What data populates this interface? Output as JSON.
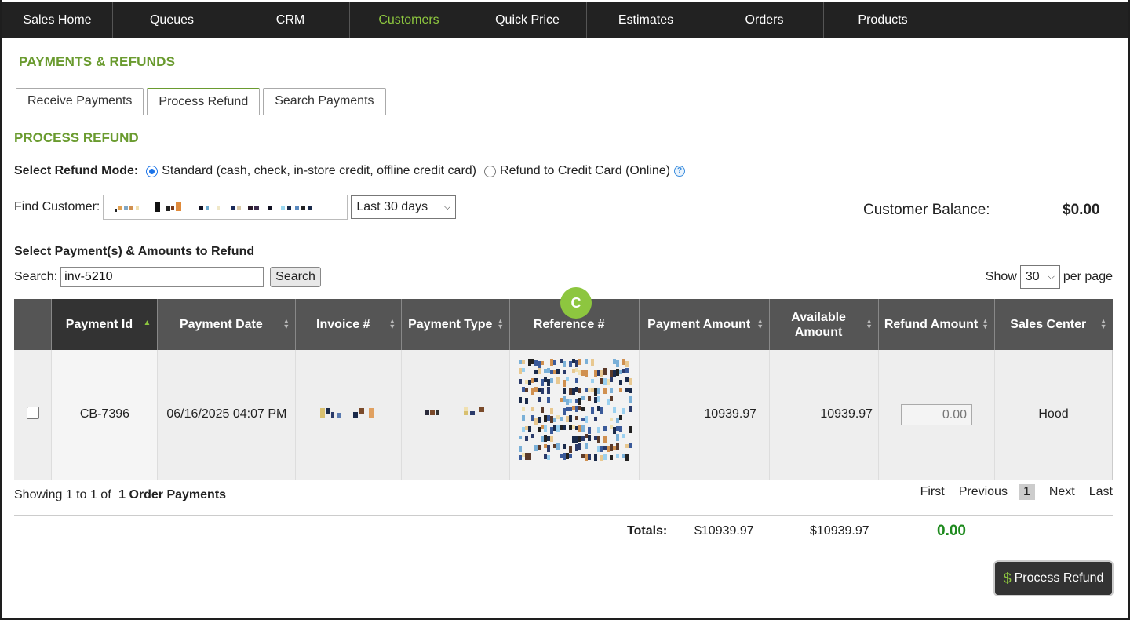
{
  "nav": {
    "items": [
      "Sales Home",
      "Queues",
      "CRM",
      "Customers",
      "Quick Price",
      "Estimates",
      "Orders",
      "Products"
    ],
    "active": "Customers",
    "active_color": "#8dc63f"
  },
  "page_title": "PAYMENTS & REFUNDS",
  "tabs": [
    "Receive Payments",
    "Process Refund",
    "Search Payments"
  ],
  "section_title": "PROCESS REFUND",
  "refund_mode": {
    "label": "Select Refund Mode:",
    "options": [
      "Standard (cash, check, in-store credit, offline credit card)",
      "Refund to Credit Card (Online)"
    ],
    "selected": 0,
    "help_icon": "help-icon"
  },
  "find_customer": {
    "label": "Find Customer:",
    "range": "Last 30 days"
  },
  "customer_balance": {
    "label": "Customer Balance:",
    "value": "$0.00"
  },
  "select_title": "Select Payment(s) & Amounts to Refund",
  "search": {
    "label": "Search:",
    "value": "inv-5210",
    "button": "Search"
  },
  "show": {
    "label": "Show",
    "value": "30",
    "suffix": "per page"
  },
  "table": {
    "headers": [
      "Payment Id",
      "Payment Date",
      "Invoice #",
      "Payment Type",
      "Reference #",
      "Payment Amount",
      "Available Amount",
      "Refund Amount",
      "Sales Center"
    ],
    "row": {
      "payment_id": "CB-7396",
      "payment_date": "06/16/2025 04:07 PM",
      "payment_amount": "10939.97",
      "available_amount": "10939.97",
      "refund_amount": "0.00",
      "sales_center": "Hood"
    }
  },
  "marker": "C",
  "showing": {
    "text": "Showing 1 to 1 of",
    "bold": "1 Order Payments"
  },
  "pager": {
    "first": "First",
    "previous": "Previous",
    "current": "1",
    "next": "Next",
    "last": "Last"
  },
  "totals": {
    "label": "Totals:",
    "payment": "$10939.97",
    "available": "$10939.97",
    "refund": "0.00"
  },
  "process_button": {
    "icon": "$",
    "label": "Process Refund"
  }
}
